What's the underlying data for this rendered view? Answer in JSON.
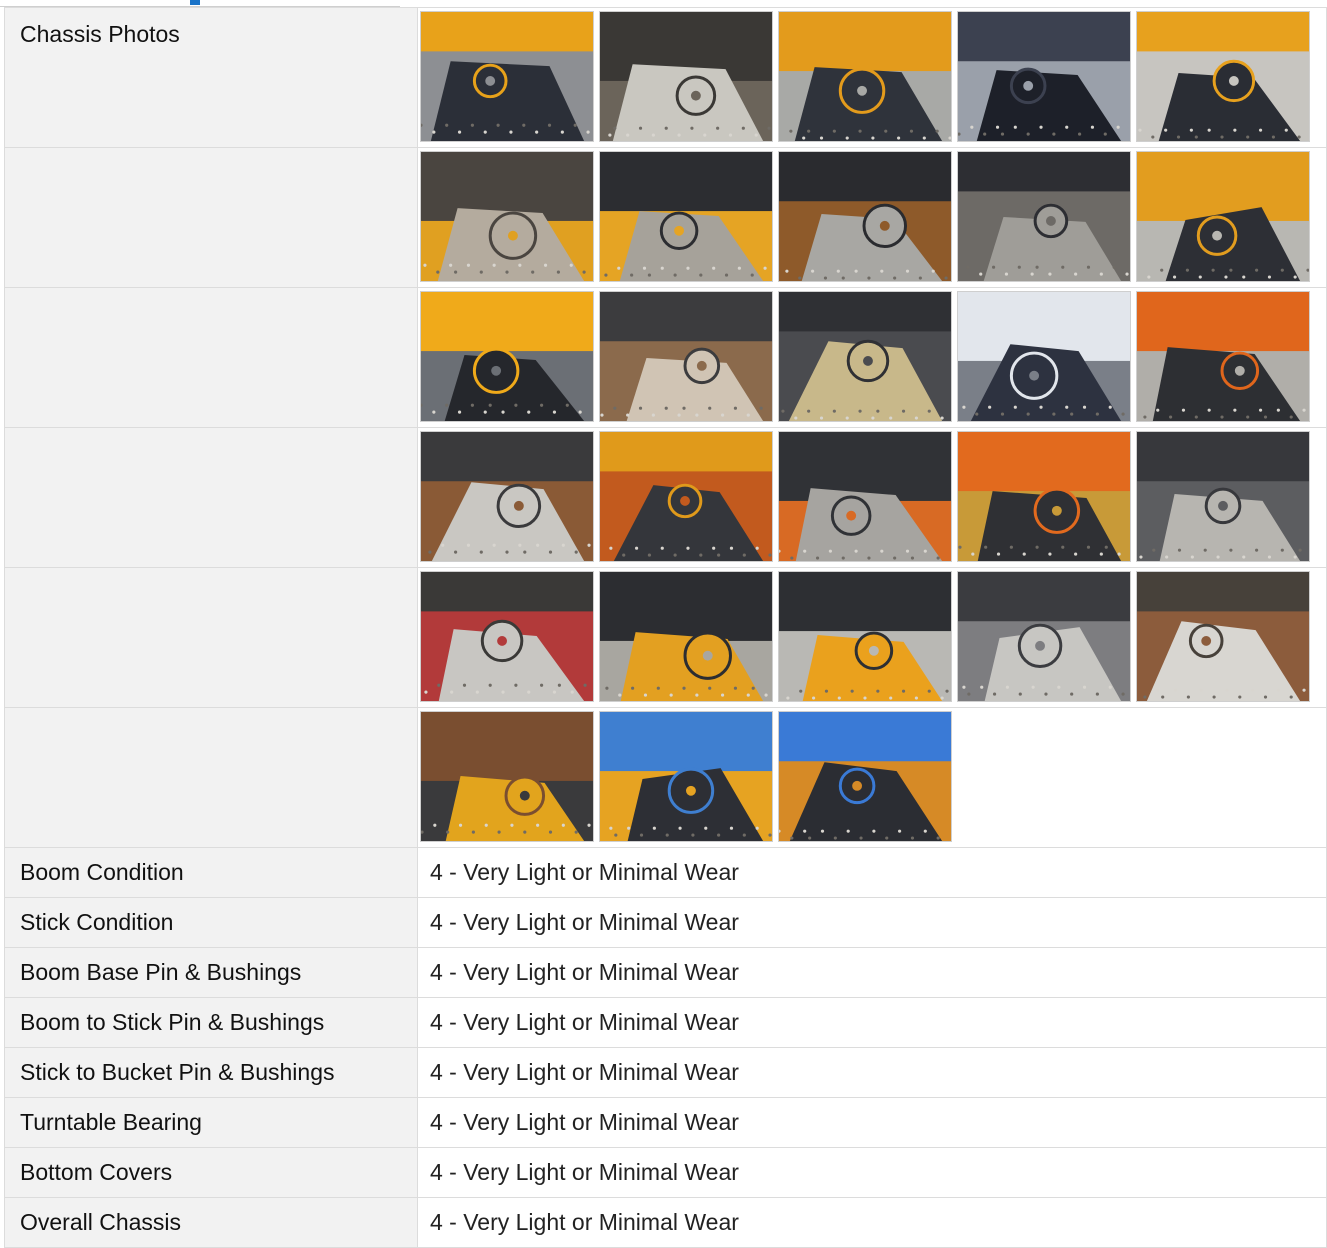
{
  "colors": {
    "accent": "#1a73c8",
    "label_bg": "#f2f2f2",
    "border": "#dcdcdc"
  },
  "chassis_photos": {
    "label": "Chassis Photos",
    "rows": [
      [
        {
          "icon": "photo-chassis-swing-joint",
          "palette": [
            "#e8a21a",
            "#2b2f38",
            "#8d8f93"
          ]
        },
        {
          "icon": "photo-chassis-underside",
          "palette": [
            "#3a3835",
            "#c9c7c0",
            "#6b645a"
          ]
        },
        {
          "icon": "photo-chassis-crossmember",
          "palette": [
            "#e39b1c",
            "#2f333b",
            "#a8a9a6"
          ]
        },
        {
          "icon": "photo-chassis-plate",
          "palette": [
            "#3c4150",
            "#1d2029",
            "#9aa0aa"
          ]
        },
        {
          "icon": "photo-chassis-side-frame",
          "palette": [
            "#e7a11e",
            "#2a2d34",
            "#c7c5c0"
          ]
        }
      ],
      [
        {
          "icon": "photo-swing-cylinder",
          "palette": [
            "#4a4540",
            "#b4ab9e",
            "#e0a021"
          ]
        },
        {
          "icon": "photo-undercarriage-frame",
          "palette": [
            "#2c2d31",
            "#a6a29a",
            "#e5a424"
          ]
        },
        {
          "icon": "photo-track-front",
          "palette": [
            "#2a2b2f",
            "#a8a7a3",
            "#8e5a2a"
          ]
        },
        {
          "icon": "photo-track-side",
          "palette": [
            "#2d2e33",
            "#9f9d98",
            "#6d6a66"
          ]
        },
        {
          "icon": "photo-blade-arm",
          "palette": [
            "#e29d1f",
            "#2d2f35",
            "#b8b7b2"
          ]
        }
      ],
      [
        {
          "icon": "photo-hose-mount",
          "palette": [
            "#f0aa1a",
            "#25272c",
            "#6b6f75"
          ]
        },
        {
          "icon": "photo-boom-pin-weld",
          "palette": [
            "#3c3c3e",
            "#d0c4b4",
            "#8b6a4c"
          ]
        },
        {
          "icon": "photo-boom-base-grease",
          "palette": [
            "#2f3034",
            "#c8b88a",
            "#4a4b4f"
          ]
        },
        {
          "icon": "photo-stick-cylinder",
          "palette": [
            "#e2e6ec",
            "#2d3240",
            "#7a7f88"
          ]
        },
        {
          "icon": "photo-orange-pin",
          "palette": [
            "#e0661c",
            "#2d2f33",
            "#b0aea9"
          ]
        }
      ],
      [
        {
          "icon": "photo-stick-joint",
          "palette": [
            "#3a3a3c",
            "#c9c7c2",
            "#8a5a36"
          ]
        },
        {
          "icon": "photo-boom-yellow-pin",
          "palette": [
            "#e09a1b",
            "#34363b",
            "#c25a1e"
          ]
        },
        {
          "icon": "photo-bucket-link",
          "palette": [
            "#303236",
            "#a6a4a0",
            "#d86a24"
          ]
        },
        {
          "icon": "photo-orange-bushing",
          "palette": [
            "#e26a1e",
            "#2f3034",
            "#c89a38"
          ]
        },
        {
          "icon": "photo-bucket-mount",
          "palette": [
            "#37383c",
            "#b7b5b0",
            "#5c5d60"
          ]
        }
      ],
      [
        {
          "icon": "photo-pin-hose",
          "palette": [
            "#3a3937",
            "#c8c6c2",
            "#b23a3a"
          ]
        },
        {
          "icon": "photo-boom-bottom",
          "palette": [
            "#2c2d31",
            "#e3a021",
            "#a8a6a0"
          ]
        },
        {
          "icon": "photo-boom-foot",
          "palette": [
            "#2d2f33",
            "#eaa11d",
            "#b9b8b4"
          ]
        },
        {
          "icon": "photo-stick-end",
          "palette": [
            "#3b3c40",
            "#c7c6c2",
            "#7d7d80"
          ]
        },
        {
          "icon": "photo-stick-plate",
          "palette": [
            "#47413a",
            "#d8d6d1",
            "#8c5c3c"
          ]
        }
      ],
      [
        {
          "icon": "photo-rusty-pin",
          "palette": [
            "#7a4e30",
            "#e2a41d",
            "#3a3a3c"
          ]
        },
        {
          "icon": "photo-excavator-yard",
          "palette": [
            "#3f7fd0",
            "#2d2f35",
            "#e6a322"
          ]
        },
        {
          "icon": "photo-excavator-deere",
          "palette": [
            "#3a7ad6",
            "#2b2d33",
            "#d68a26"
          ]
        }
      ]
    ]
  },
  "conditions": [
    {
      "label": "Boom Condition",
      "value": "4 - Very Light or Minimal Wear"
    },
    {
      "label": "Stick Condition",
      "value": "4 - Very Light or Minimal Wear"
    },
    {
      "label": "Boom Base Pin & Bushings",
      "value": "4 - Very Light or Minimal Wear"
    },
    {
      "label": "Boom to Stick Pin & Bushings",
      "value": "4 - Very Light or Minimal Wear"
    },
    {
      "label": "Stick to Bucket Pin & Bushings",
      "value": "4 - Very Light or Minimal Wear"
    },
    {
      "label": "Turntable Bearing",
      "value": "4 - Very Light or Minimal Wear"
    },
    {
      "label": "Bottom Covers",
      "value": "4 - Very Light or Minimal Wear"
    },
    {
      "label": "Overall Chassis",
      "value": "4 - Very Light or Minimal Wear"
    }
  ]
}
